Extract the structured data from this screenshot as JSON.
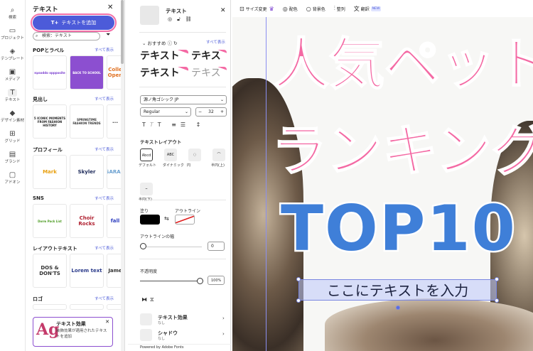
{
  "rail": [
    {
      "icon": "⌕",
      "label": "検索"
    },
    {
      "icon": "▭",
      "label": "プロジェクト"
    },
    {
      "icon": "◈",
      "label": "テンプレート"
    },
    {
      "icon": "▣",
      "label": "メディア"
    },
    {
      "icon": "T",
      "label": "テキスト"
    },
    {
      "icon": "◆",
      "label": "デザイン素材"
    },
    {
      "icon": "⊞",
      "label": "グリッド"
    },
    {
      "icon": "▤",
      "label": "ブランド"
    },
    {
      "icon": "▢",
      "label": "アドオン"
    }
  ],
  "panel": {
    "title": "テキスト",
    "add_button": "テキストを追加",
    "search_placeholder": "検索：テキスト",
    "see_all": "すべて表示",
    "sections": [
      {
        "title": "POPとラベル",
        "thumbs": [
          "əʇısoddo oppposite",
          "BACK TO SCHOOL",
          "Colle Open"
        ]
      },
      {
        "title": "見出し",
        "thumbs": [
          "5 ICONIC MOMENTS FROM FASHION HISTORY",
          "SPRINGTIME FASHION TRENDS",
          "..."
        ]
      },
      {
        "title": "プロフィール",
        "thumbs": [
          "Mark",
          "Skyler",
          "SARAH"
        ]
      },
      {
        "title": "SNS",
        "thumbs": [
          "Dorm Pack List",
          "Choir Rocks",
          "fall"
        ]
      },
      {
        "title": "レイアウトテキスト",
        "thumbs": [
          "DOS & DON'TS",
          "Lorem text",
          "Jame"
        ]
      },
      {
        "title": "ロゴ",
        "thumbs": []
      }
    ],
    "promo": {
      "title": "テキスト効果",
      "desc": "装飾効果が適用されたテキストを追加",
      "glyph": "Ag"
    }
  },
  "props": {
    "title": "テキスト",
    "recommended": "おすすめ",
    "see_all": "すべて表示",
    "samples": [
      "テキスト",
      "テキス",
      "テキスト",
      "テキス"
    ],
    "font": "源ノ角ゴシック JP",
    "weight": "Regular",
    "size": "32",
    "layout_title": "テキストレイアウト",
    "layouts": [
      "デフォルト",
      "ダイナミック",
      "円",
      "半円(上)",
      "半円(下)"
    ],
    "fill_label": "塗り",
    "outline_label": "アウトライン",
    "outline_width_label": "アウトラインの幅",
    "outline_width": "0",
    "opacity_label": "不透明度",
    "opacity": "100%",
    "opacity_value": 100,
    "effects": [
      {
        "title": "テキスト効果",
        "sub": "なし"
      },
      {
        "title": "シャドウ",
        "sub": "なし"
      }
    ],
    "powered": "Powered by Adobe Fonts",
    "colors": {
      "fill": "#000000",
      "accent": "#4c5bd9"
    }
  },
  "toolbar": {
    "items": [
      "サイズ変更",
      "配色",
      "背景色",
      "整列",
      "翻訳"
    ],
    "new_badge": "NEW"
  },
  "canvas": {
    "line1": "人気ペット",
    "line2": "ランキング",
    "line3": "TOP10",
    "line4": "ここにテキストを入力",
    "colors": {
      "pink": "#f46aa4",
      "blue": "#3f7fd8"
    }
  }
}
